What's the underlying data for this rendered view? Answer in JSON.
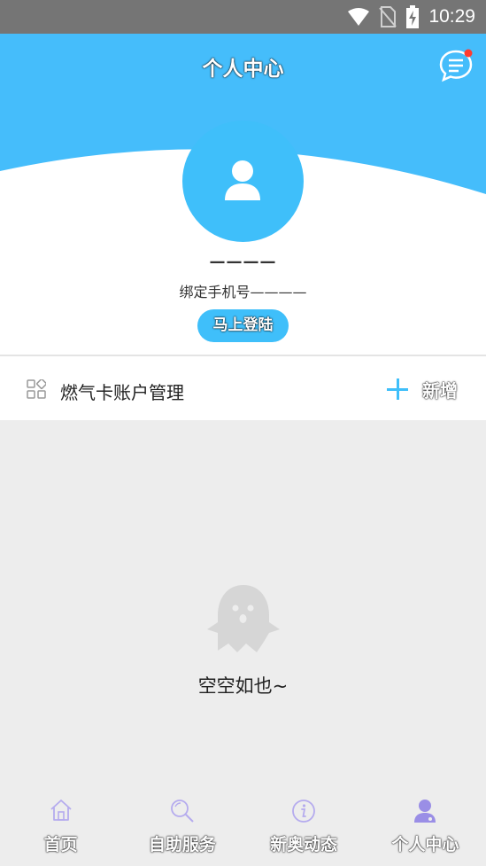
{
  "status_bar": {
    "time": "10:29"
  },
  "header": {
    "title": "个人中心",
    "user_name": "————",
    "phone_line": "绑定手机号————",
    "login_label": "马上登陆"
  },
  "section": {
    "title": "燃气卡账户管理",
    "add_label": "新增"
  },
  "empty_state": {
    "text": "空空如也~"
  },
  "tabbar": {
    "items": [
      {
        "label": "首页",
        "icon": "home-icon",
        "active": false
      },
      {
        "label": "自助服务",
        "icon": "search-icon",
        "active": false
      },
      {
        "label": "新奥动态",
        "icon": "info-icon",
        "active": false
      },
      {
        "label": "个人中心",
        "icon": "user-icon",
        "active": true
      }
    ]
  },
  "colors": {
    "accent": "#3fbffa",
    "tab_icon": "#9a8ee6",
    "notification_dot": "#ff3b30"
  }
}
